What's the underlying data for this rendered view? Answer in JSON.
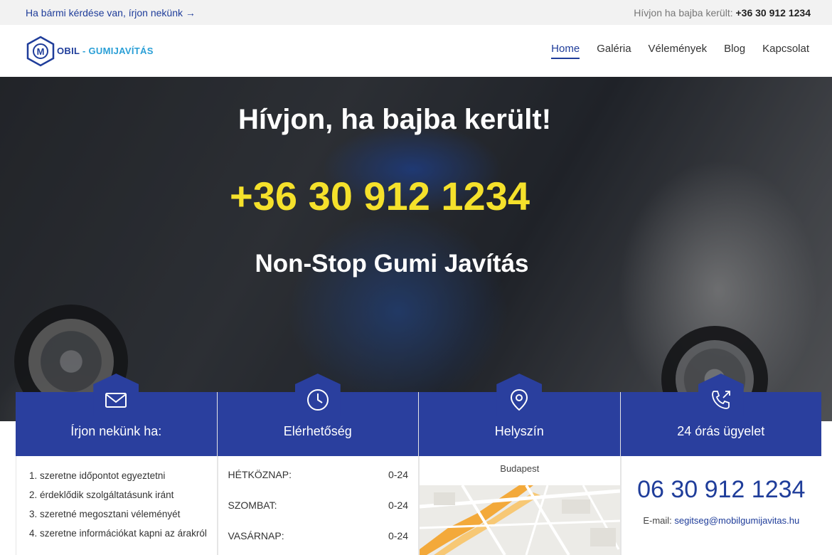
{
  "topbar": {
    "left_link": "Ha bármi kérdése van, írjon nekünk →",
    "right_label": "Hívjon ha bajba került:",
    "right_phone": "+36 30 912 1234"
  },
  "header": {
    "logo_letter": "M",
    "logo_part1": "OBIL",
    "logo_part2": " - GUMIJAVÍTÁS",
    "nav": [
      "Home",
      "Galéria",
      "Vélemények",
      "Blog",
      "Kapcsolat"
    ],
    "active_nav": "Home"
  },
  "hero": {
    "title": "Hívjon, ha bajba került!",
    "phone": "+36 30 912 1234",
    "subtitle": "Non-Stop Gumi Javítás"
  },
  "features": {
    "write": {
      "icon": "envelope-icon",
      "title": "Írjon nekünk ha:",
      "items": [
        "1. szeretne időpontot egyeztetni",
        "2. érdeklődik szolgáltatásunk iránt",
        "3. szeretné megosztani véleményét",
        "4. szeretne információkat kapni az árakról"
      ]
    },
    "availability": {
      "icon": "clock-icon",
      "title": "Elérhetőség",
      "rows": [
        {
          "day": "HÉTKÖZNAP:",
          "hours": "0-24"
        },
        {
          "day": "SZOMBAT:",
          "hours": "0-24"
        },
        {
          "day": "VASÁRNAP:",
          "hours": "0-24"
        }
      ]
    },
    "location": {
      "icon": "map-pin-icon",
      "title": "Helyszín",
      "city": "Budapest"
    },
    "service": {
      "icon": "phone-call-icon",
      "title": "24 órás ügyelet",
      "phone": "06 30 912 1234",
      "email_label": "E-mail:",
      "email": "segitseg@mobilgumijavitas.hu"
    }
  },
  "colors": {
    "brand_blue": "#2a3f9e",
    "accent_yellow": "#f5e12b",
    "logo_cyan": "#2a9fd6"
  }
}
